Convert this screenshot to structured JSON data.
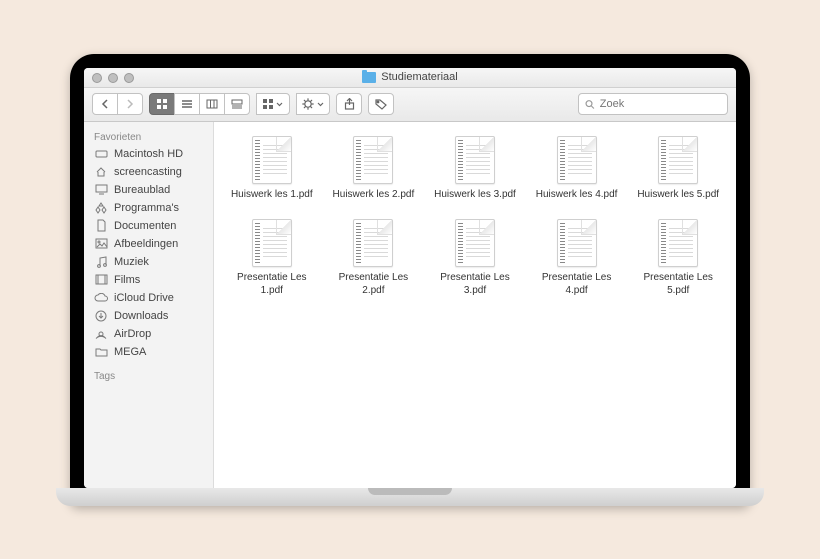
{
  "window": {
    "title": "Studiemateriaal"
  },
  "toolbar": {
    "search_placeholder": "Zoek"
  },
  "sidebar": {
    "favorites_label": "Favorieten",
    "tags_label": "Tags",
    "items": [
      {
        "label": "Macintosh HD",
        "icon": "drive"
      },
      {
        "label": "screencasting",
        "icon": "house"
      },
      {
        "label": "Bureaublad",
        "icon": "desktop"
      },
      {
        "label": "Programma's",
        "icon": "apps"
      },
      {
        "label": "Documenten",
        "icon": "docs"
      },
      {
        "label": "Afbeeldingen",
        "icon": "images"
      },
      {
        "label": "Muziek",
        "icon": "music"
      },
      {
        "label": "Films",
        "icon": "films"
      },
      {
        "label": "iCloud Drive",
        "icon": "cloud"
      },
      {
        "label": "Downloads",
        "icon": "downloads"
      },
      {
        "label": "AirDrop",
        "icon": "airdrop"
      },
      {
        "label": "MEGA",
        "icon": "folder"
      }
    ]
  },
  "files": [
    {
      "name": "Huiswerk les 1.pdf"
    },
    {
      "name": "Huiswerk les 2.pdf"
    },
    {
      "name": "Huiswerk les 3.pdf"
    },
    {
      "name": "Huiswerk les 4.pdf"
    },
    {
      "name": "Huiswerk les 5.pdf"
    },
    {
      "name": "Presentatie Les 1.pdf"
    },
    {
      "name": "Presentatie Les 2.pdf"
    },
    {
      "name": "Presentatie Les 3.pdf"
    },
    {
      "name": "Presentatie Les 4.pdf"
    },
    {
      "name": "Presentatie Les 5.pdf"
    }
  ]
}
